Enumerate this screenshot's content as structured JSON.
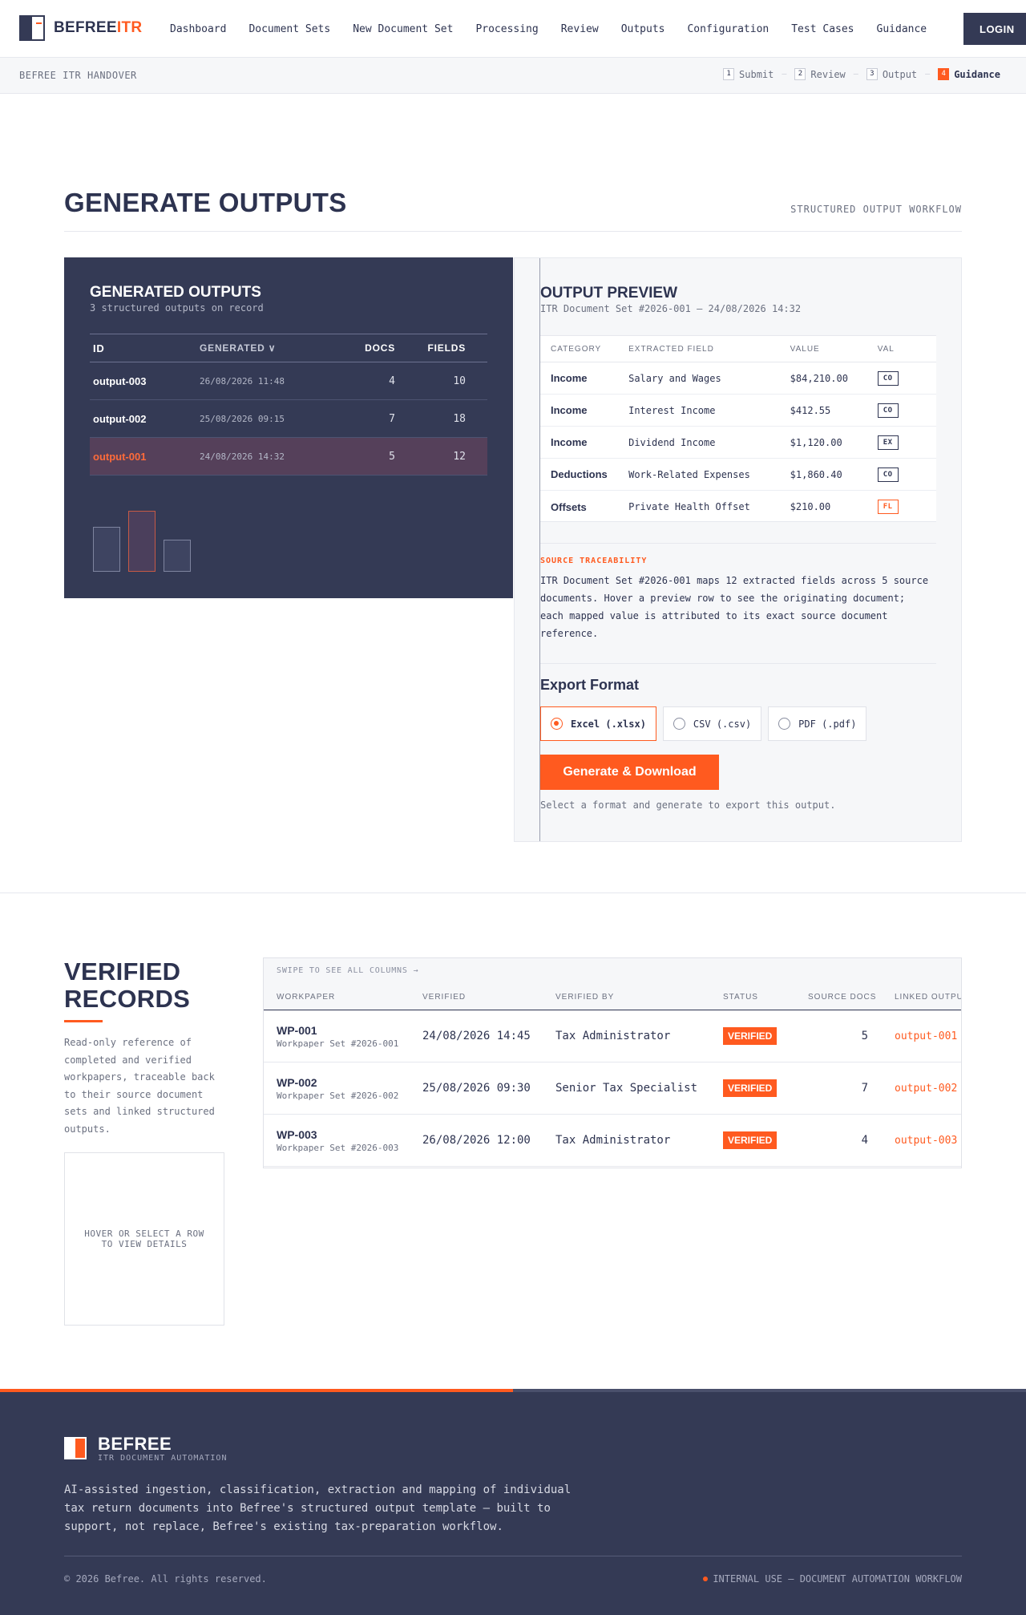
{
  "brand": {
    "name_a": "BEFREE",
    "name_b": "ITR"
  },
  "nav": {
    "links": [
      "Dashboard",
      "Document Sets",
      "New Document Set",
      "Processing",
      "Review",
      "Outputs",
      "Configuration",
      "Test Cases",
      "Guidance"
    ],
    "login": "LOGIN"
  },
  "stepbar": {
    "label": "BEFREE ITR HANDOVER",
    "steps": [
      {
        "num": "1",
        "label": "Submit"
      },
      {
        "num": "2",
        "label": "Review"
      },
      {
        "num": "3",
        "label": "Output"
      },
      {
        "num": "4",
        "label": "Guidance"
      }
    ],
    "separator": "—"
  },
  "page": {
    "title": "GENERATE OUTPUTS",
    "workflow_label": "STRUCTURED OUTPUT WORKFLOW"
  },
  "generated": {
    "title": "GENERATED OUTPUTS",
    "subtitle": "3 structured outputs on record",
    "headers": {
      "id": "ID",
      "generated": "GENERATED ∨",
      "docs": "DOCS",
      "fields": "FIELDS"
    },
    "rows": [
      {
        "id": "output-003",
        "generated": "26/08/2026 11:48",
        "docs": "4",
        "fields": "10"
      },
      {
        "id": "output-002",
        "generated": "25/08/2026 09:15",
        "docs": "7",
        "fields": "18"
      },
      {
        "id": "output-001",
        "generated": "24/08/2026 14:32",
        "docs": "5",
        "fields": "12"
      }
    ]
  },
  "preview": {
    "title": "OUTPUT PREVIEW",
    "subtitle": "ITR Document Set #2026-001 – 24/08/2026 14:32",
    "headers": {
      "category": "CATEGORY",
      "field": "EXTRACTED FIELD",
      "value": "VALUE",
      "conf": "VAL"
    },
    "rows": [
      {
        "category": "Income",
        "field": "Salary and Wages",
        "value": "$84,210.00",
        "chip": "CO"
      },
      {
        "category": "Income",
        "field": "Interest Income",
        "value": "$412.55",
        "chip": "CO"
      },
      {
        "category": "Income",
        "field": "Dividend Income",
        "value": "$1,120.00",
        "chip": "EX"
      },
      {
        "category": "Deductions",
        "field": "Work-Related Expenses",
        "value": "$1,860.40",
        "chip": "CO"
      },
      {
        "category": "Offsets",
        "field": "Private Health Offset",
        "value": "$210.00",
        "chip": "FL"
      }
    ],
    "trace_label": "SOURCE TRACEABILITY",
    "trace_text": "ITR Document Set #2026-001 maps 12 extracted fields across 5 source documents. Hover a preview row to see the originating document; each mapped value is attributed to its exact source document reference.",
    "export_title": "Export Format",
    "formats": [
      "Excel (.xlsx)",
      "CSV (.csv)",
      "PDF (.pdf)"
    ],
    "selected_format": "Excel (.xlsx)",
    "generate_label": "Generate & Download",
    "hint": "Select a format and generate to export this output."
  },
  "verified": {
    "title_line1": "VERIFIED",
    "title_line2": "RECORDS",
    "description": "Read-only reference of completed and verified workpapers, traceable back to their source document sets and linked structured outputs.",
    "detail_placeholder": "HOVER OR SELECT A ROW TO VIEW DETAILS",
    "swipe_hint": "SWIPE TO SEE ALL COLUMNS →",
    "headers": {
      "workpaper": "WORKPAPER",
      "verified": "VERIFIED",
      "by": "VERIFIED BY",
      "status": "STATUS",
      "docs": "SOURCE DOCS",
      "linked": "LINKED OUTPUT"
    },
    "rows": [
      {
        "id": "WP-001",
        "set": "Workpaper Set #2026-001",
        "verified": "24/08/2026 14:45",
        "by": "Tax Administrator",
        "status": "VERIFIED",
        "docs": "5",
        "linked": "output-001"
      },
      {
        "id": "WP-002",
        "set": "Workpaper Set #2026-002",
        "verified": "25/08/2026 09:30",
        "by": "Senior Tax Specialist",
        "status": "VERIFIED",
        "docs": "7",
        "linked": "output-002"
      },
      {
        "id": "WP-003",
        "set": "Workpaper Set #2026-003",
        "verified": "26/08/2026 12:00",
        "by": "Tax Administrator",
        "status": "VERIFIED",
        "docs": "4",
        "linked": "output-003"
      }
    ]
  },
  "footer": {
    "brand": "BEFREE",
    "brand_sub": "ITR DOCUMENT AUTOMATION",
    "description": "AI-assisted ingestion, classification, extraction and mapping of individual tax return documents into Befree's structured output template — built to support, not replace, Befree's existing tax-preparation workflow.",
    "copyright": "© 2026 Befree. All rights reserved.",
    "internal": "INTERNAL USE — DOCUMENT AUTOMATION WORKFLOW"
  },
  "colors": {
    "accent": "#ff5a1f",
    "navy": "#343a55"
  },
  "icons": {
    "logo": "split-square-logo-icon",
    "radio": "radio-icon",
    "dot": "status-dot-icon"
  }
}
